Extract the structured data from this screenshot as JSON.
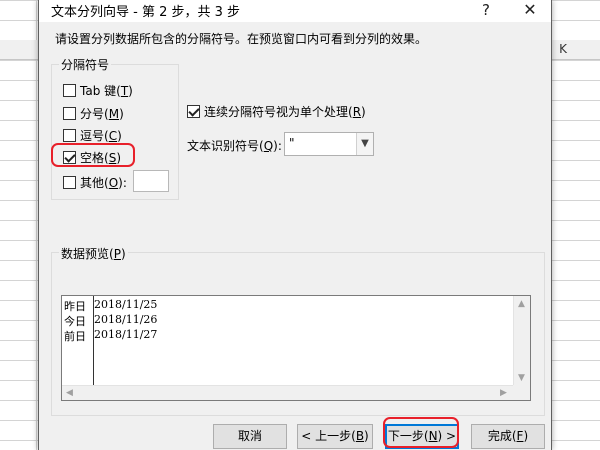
{
  "spreadsheet": {
    "column_header_visible": "K"
  },
  "dialog": {
    "title": "文本分列向导 - 第 2 步，共 3 步",
    "help_glyph": "?",
    "close_glyph": "✕",
    "instruction": "请设置分列数据所包含的分隔符号。在预览窗口内可看到分列的效果。"
  },
  "delimiters": {
    "group_label": "分隔符号",
    "items": [
      {
        "label": "Tab 键",
        "key": "T",
        "checked": false
      },
      {
        "label": "分号",
        "key": "M",
        "checked": false
      },
      {
        "label": "逗号",
        "key": "C",
        "checked": false
      },
      {
        "label": "空格",
        "key": "S",
        "checked": true
      },
      {
        "label": "其他",
        "key": "O",
        "checked": false,
        "suffix": ":"
      }
    ],
    "other_value": ""
  },
  "options": {
    "consecutive_label": "连续分隔符号视为单个处理",
    "consecutive_key": "R",
    "consecutive_checked": true,
    "qualifier_label": "文本识别符号",
    "qualifier_key": "Q",
    "qualifier_value": "\""
  },
  "preview": {
    "group_label": "数据预览",
    "group_key": "P",
    "rows": [
      {
        "col1": "昨日",
        "col2": "2018/11/25"
      },
      {
        "col1": "今日",
        "col2": "2018/11/26"
      },
      {
        "col1": "前日",
        "col2": "2018/11/27"
      }
    ]
  },
  "buttons": {
    "cancel": "取消",
    "back_prefix": "< 上一步(",
    "back_key": "B",
    "back_suffix": ")",
    "next_prefix": "下一步(",
    "next_key": "N",
    "next_suffix": ") >",
    "finish_prefix": "完成(",
    "finish_key": "F",
    "finish_suffix": ")"
  },
  "colors": {
    "highlight": "#e8202a",
    "default_button_border": "#0078d7",
    "dialog_bg": "#f0f0f0"
  }
}
